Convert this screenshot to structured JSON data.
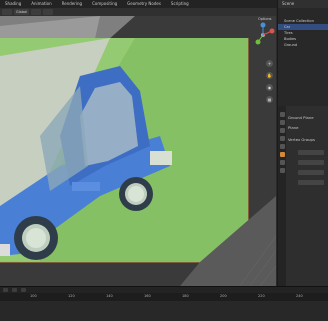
{
  "workspace_tabs": [
    "Shading",
    "Animation",
    "Rendering",
    "Compositing",
    "Geometry Nodes",
    "Scripting"
  ],
  "viewport": {
    "options_label": "Options",
    "shading_mode": "Global"
  },
  "outliner": {
    "title": "Scene",
    "items": [
      {
        "label": "Scene Collection",
        "selected": false
      },
      {
        "label": "Car",
        "selected": true
      },
      {
        "label": "Tires",
        "selected": false
      },
      {
        "label": "Bodies",
        "selected": false
      },
      {
        "label": "Ground",
        "selected": false
      }
    ]
  },
  "properties": {
    "object_name": "Ground Plane",
    "mesh_name": "Plane",
    "section_label": "Vertex Groups"
  },
  "timeline": {
    "frame_numbers": [
      "100",
      "120",
      "140",
      "160",
      "180",
      "200",
      "220",
      "240"
    ]
  },
  "colors": {
    "car_body": "#4a7fd6",
    "ground": "#8bc56a",
    "accent": "#e89a3c"
  }
}
